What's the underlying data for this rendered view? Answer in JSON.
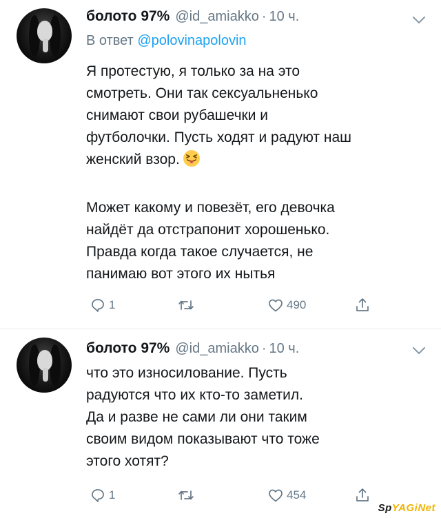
{
  "tweets": [
    {
      "display_name": "болото 97%",
      "handle": "@id_amiakko",
      "dot": "·",
      "time": "10 ч.",
      "reply_prefix": "В ответ",
      "reply_mention": "@polovinapolovin",
      "paragraph_1": "Я протестую, я только за на это\nсмотреть. Они так сексуальненько\nснимают свои рубашечки и\nфутболочки. Пусть ходят и радуют наш\nженский взор.",
      "emoji": "squinting-face-with-tongue",
      "paragraph_2": "Может какому и повезёт, его девочка\nнайдёт да отстрапонит хорошенько.\nПравда когда такое случается, не\nпанимаю вот этого их нытья",
      "replies": "1",
      "retweets": "",
      "likes": "490"
    },
    {
      "display_name": "болото 97%",
      "handle": "@id_amiakko",
      "dot": "·",
      "time": "10 ч.",
      "body": "что это износилование. Пусть\nрадуются что их кто-то заметил.\nДа и разве не сами ли они таким\nсвоим видом показывают что тоже\nэтого хотят?",
      "replies": "1",
      "retweets": "",
      "likes": "454"
    }
  ],
  "icons": {
    "reply": "reply-icon",
    "retweet": "retweet-icon",
    "like": "heart-icon",
    "share": "share-icon",
    "menu": "chevron-down-icon"
  },
  "colors": {
    "text": "#14171a",
    "secondary": "#657786",
    "link": "#1da1f2",
    "divider": "#e6ecf0"
  },
  "watermark": {
    "part1": "Sp",
    "part2": "YAGiNet"
  }
}
